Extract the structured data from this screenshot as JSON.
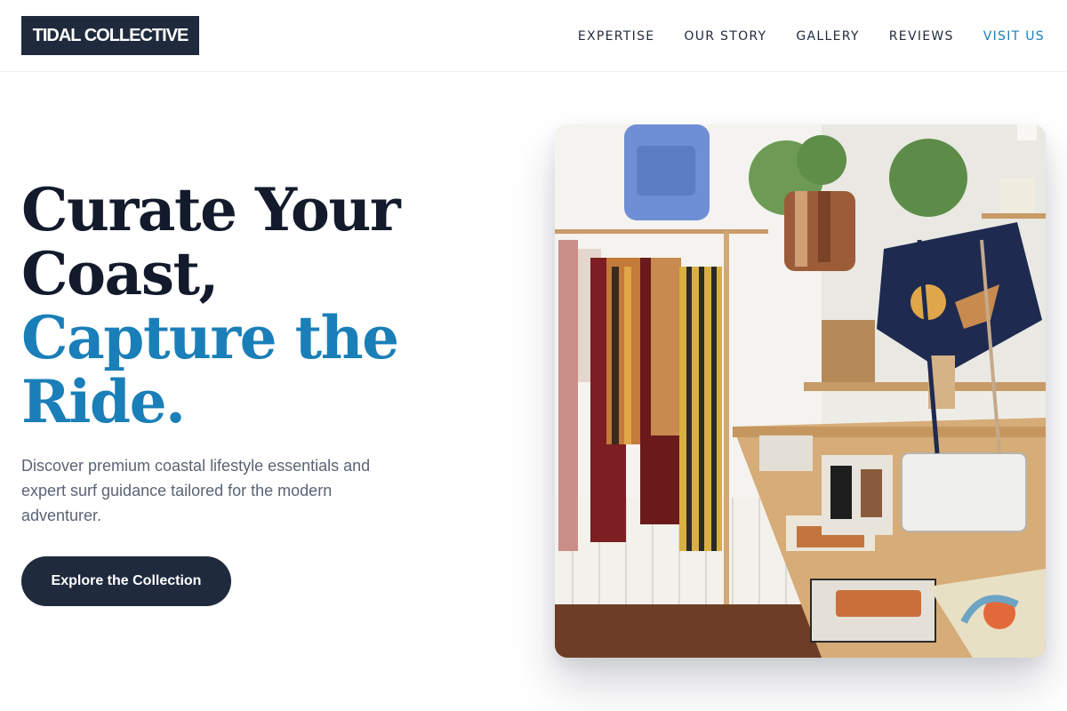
{
  "header": {
    "logo": "TIDAL COLLECTIVE",
    "nav": [
      {
        "label": "EXPERTISE"
      },
      {
        "label": "OUR STORY"
      },
      {
        "label": "GALLERY"
      },
      {
        "label": "REVIEWS"
      },
      {
        "label": "VISIT US"
      }
    ]
  },
  "hero": {
    "title_line1": "Curate Your",
    "title_line2": "Coast,",
    "title_line3": "Capture the",
    "title_line4": "Ride.",
    "description": "Discover premium coastal lifestyle essentials and expert surf guidance tailored for the modern adventurer.",
    "cta_label": "Explore the Collection"
  },
  "colors": {
    "navy": "#1f2a3d",
    "accent": "#1a7fb8",
    "text_muted": "#5a6374"
  }
}
